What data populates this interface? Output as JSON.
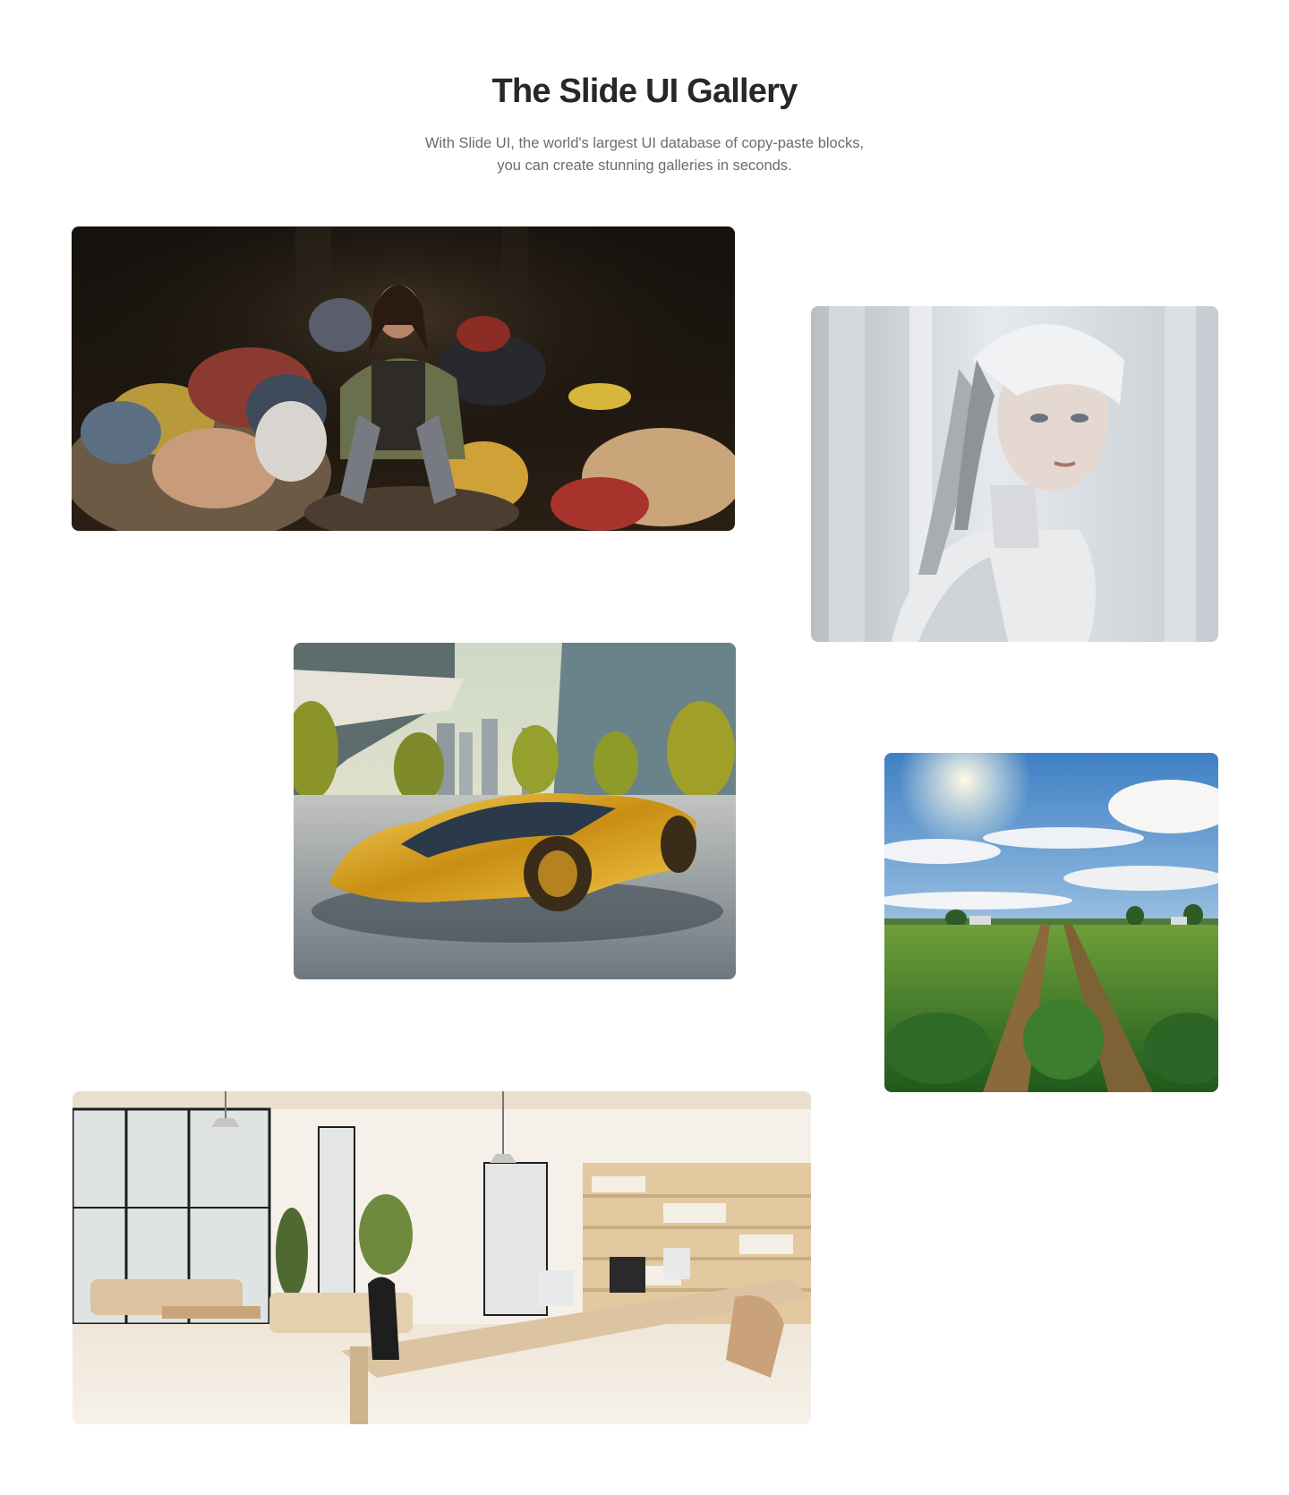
{
  "header": {
    "title": "The Slide UI Gallery",
    "subtitle_line1": "With Slide UI, the world's largest UI database of copy-paste blocks,",
    "subtitle_line2": "you can create stunning galleries in seconds."
  },
  "gallery": {
    "images": [
      {
        "name": "woman-with-clothes-pile-image"
      },
      {
        "name": "robot-woman-portrait-image"
      },
      {
        "name": "golden-concept-car-image"
      },
      {
        "name": "green-crop-field-image"
      },
      {
        "name": "bright-office-interior-image"
      }
    ]
  },
  "colors": {
    "title": "#27272a",
    "subtitle": "#6b6b72",
    "background": "#ffffff"
  }
}
